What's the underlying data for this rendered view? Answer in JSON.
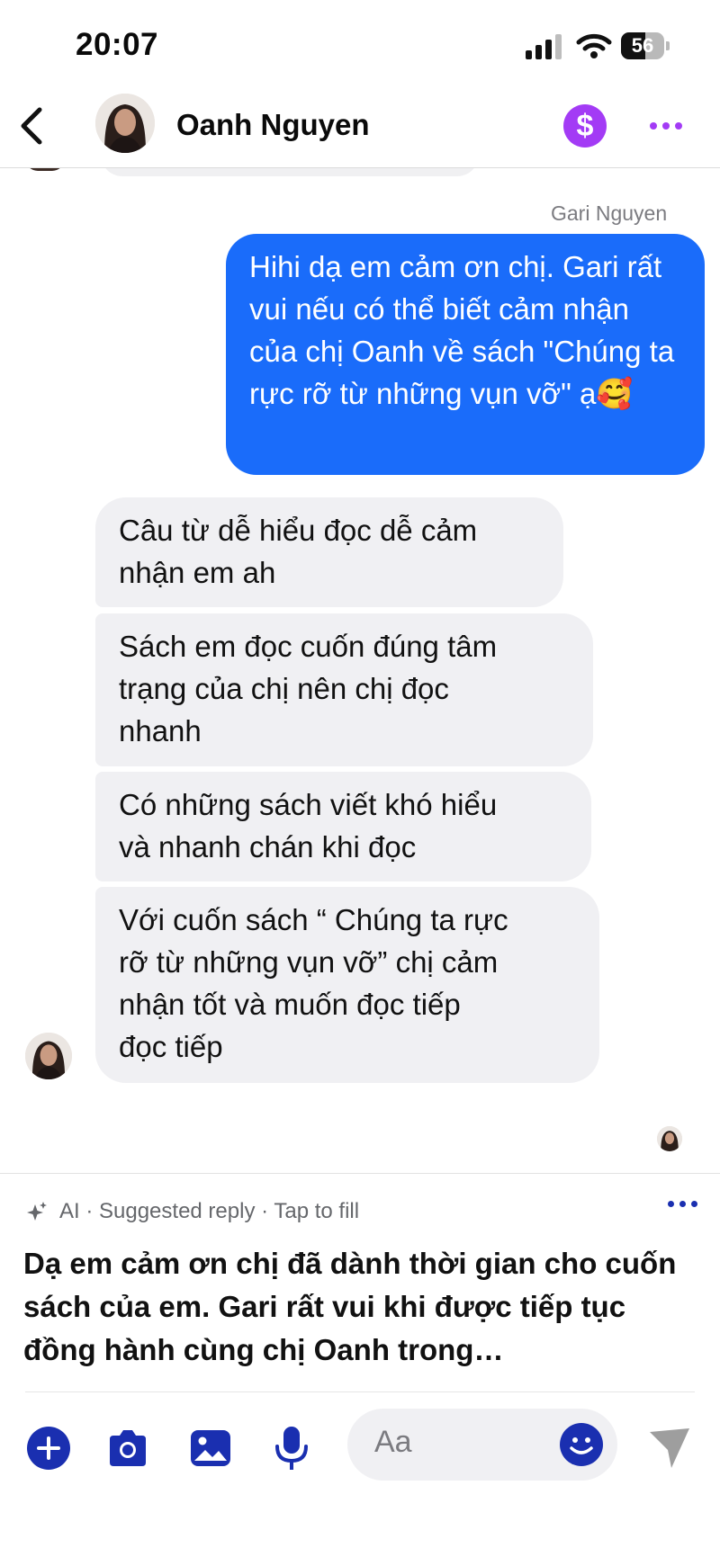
{
  "status_bar": {
    "time": "20:07",
    "battery": "56"
  },
  "header": {
    "contact_name": "Oanh Nguyen",
    "pay_symbol": "$"
  },
  "messages": {
    "sender_label": "Gari Nguyen",
    "outgoing": [
      {
        "text": "Hihi dạ em cảm ơn chị. Gari rất vui nếu có thể biết cảm nhận của chị Oanh về sách \"Chúng ta rực rỡ từ những vụn vỡ\" ạ🥰"
      }
    ],
    "incoming": [
      {
        "text": "Câu từ dễ hiểu đọc dễ cảm\nnhận em ah"
      },
      {
        "text": "Sách em đọc cuốn đúng tâm\ntrạng của chị nên chị đọc\nnhanh"
      },
      {
        "text": "Có những sách viết khó hiểu\nvà nhanh chán khi đọc"
      },
      {
        "text": "Với cuốn sách “ Chúng ta rực\nrỡ từ những vụn vỡ” chị cảm\nnhận tốt và muốn đọc tiếp\nđọc tiếp"
      }
    ]
  },
  "suggested_reply": {
    "label": "AI · Suggested reply · Tap to fill",
    "text": "Dạ em cảm ơn chị đã dành thời gian cho cuốn sách của em. Gari rất vui khi được tiếp tục đồng hành cùng chị Oanh trong…"
  },
  "composer": {
    "placeholder": "Aa",
    "icons": [
      "plus-icon",
      "camera-icon",
      "gallery-icon",
      "microphone-icon",
      "emoji-icon",
      "send-icon"
    ]
  },
  "colors": {
    "outgoing_bubble": "#1a6cfa",
    "incoming_bubble": "#f0f0f3",
    "accent_purple": "#a33bf5",
    "composer_blue": "#1a2fb0"
  }
}
